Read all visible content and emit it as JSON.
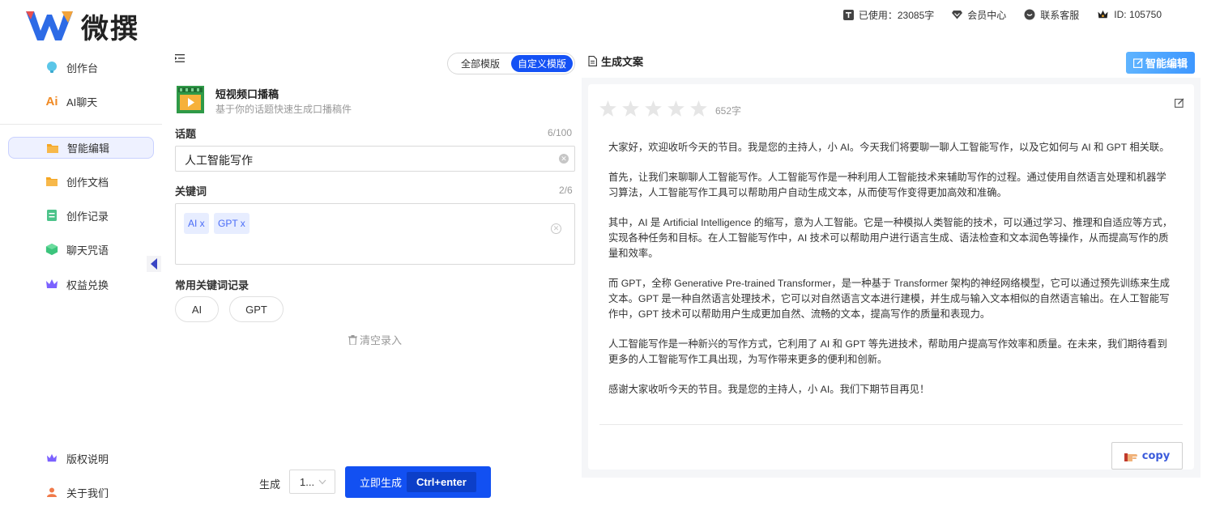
{
  "brand": {
    "name": "微撰"
  },
  "topbar": {
    "used": "已使用：23085字",
    "member": "会员中心",
    "support": "联系客服",
    "id": "ID: 105750"
  },
  "sidebar": {
    "items": [
      {
        "label": "创作台",
        "icon": "lightbulb-icon"
      },
      {
        "label": "AI聊天",
        "icon": "ai-icon"
      },
      {
        "label": "智能编辑",
        "icon": "folder-icon",
        "active": true
      },
      {
        "label": "创作文档",
        "icon": "folder-icon"
      },
      {
        "label": "创作记录",
        "icon": "document-icon"
      },
      {
        "label": "聊天咒语",
        "icon": "cube-icon"
      },
      {
        "label": "权益兑换",
        "icon": "crown-icon"
      }
    ],
    "bottom_items": [
      {
        "label": "版权说明",
        "icon": "crown-icon"
      },
      {
        "label": "关于我们",
        "icon": "user-icon"
      }
    ],
    "ai_icon_text": "Ai"
  },
  "form": {
    "template_tabs": [
      "全部模版",
      "自定义模版"
    ],
    "tool_title": "短视频口播稿",
    "tool_desc": "基于你的话题快速生成口播稿件",
    "topic_label": "话题",
    "topic_count": "6/100",
    "topic_value": "人工智能写作",
    "keywords_label": "关键词",
    "keywords_count": "2/6",
    "keywords": [
      "AI x",
      "GPT x"
    ],
    "history_label": "常用关键词记录",
    "history": [
      "AI",
      "GPT"
    ],
    "clear_history": "清空录入",
    "generate_label": "生成",
    "generate_count": "1...",
    "generate_button": "立即生成",
    "generate_shortcut": "Ctrl+enter"
  },
  "output": {
    "title": "生成文案",
    "smart_edit": "智能编辑",
    "word_count": "652字",
    "rating": 0,
    "paragraphs": [
      "大家好，欢迎收听今天的节目。我是您的主持人，小 AI。今天我们将要聊一聊人工智能写作，以及它如何与 AI 和 GPT 相关联。",
      "首先，让我们来聊聊人工智能写作。人工智能写作是一种利用人工智能技术来辅助写作的过程。通过使用自然语言处理和机器学习算法，人工智能写作工具可以帮助用户自动生成文本，从而使写作变得更加高效和准确。",
      "其中，AI 是 Artificial Intelligence 的缩写，意为人工智能。它是一种模拟人类智能的技术，可以通过学习、推理和自适应等方式，实现各种任务和目标。在人工智能写作中，AI 技术可以帮助用户进行语言生成、语法检查和文本润色等操作，从而提高写作的质量和效率。",
      "而 GPT，全称 Generative Pre-trained Transformer，是一种基于 Transformer 架构的神经网络模型，它可以通过预先训练来生成文本。GPT 是一种自然语言处理技术，它可以对自然语言文本进行建模，并生成与输入文本相似的自然语言输出。在人工智能写作中，GPT 技术可以帮助用户生成更加自然、流畅的文本，提高写作的质量和表现力。",
      "人工智能写作是一种新兴的写作方式，它利用了 AI 和 GPT 等先进技术，帮助用户提高写作效率和质量。在未来，我们期待看到更多的人工智能写作工具出现，为写作带来更多的便利和创新。",
      "感谢大家收听今天的节目。我是您的主持人，小 AI。我们下期节目再见！"
    ],
    "copy": "copy"
  },
  "colors": {
    "primary": "#1451f5",
    "accent_light": "#eef1ff",
    "tag_bg": "#e7edff",
    "smart_edit": "#3d97ff"
  }
}
